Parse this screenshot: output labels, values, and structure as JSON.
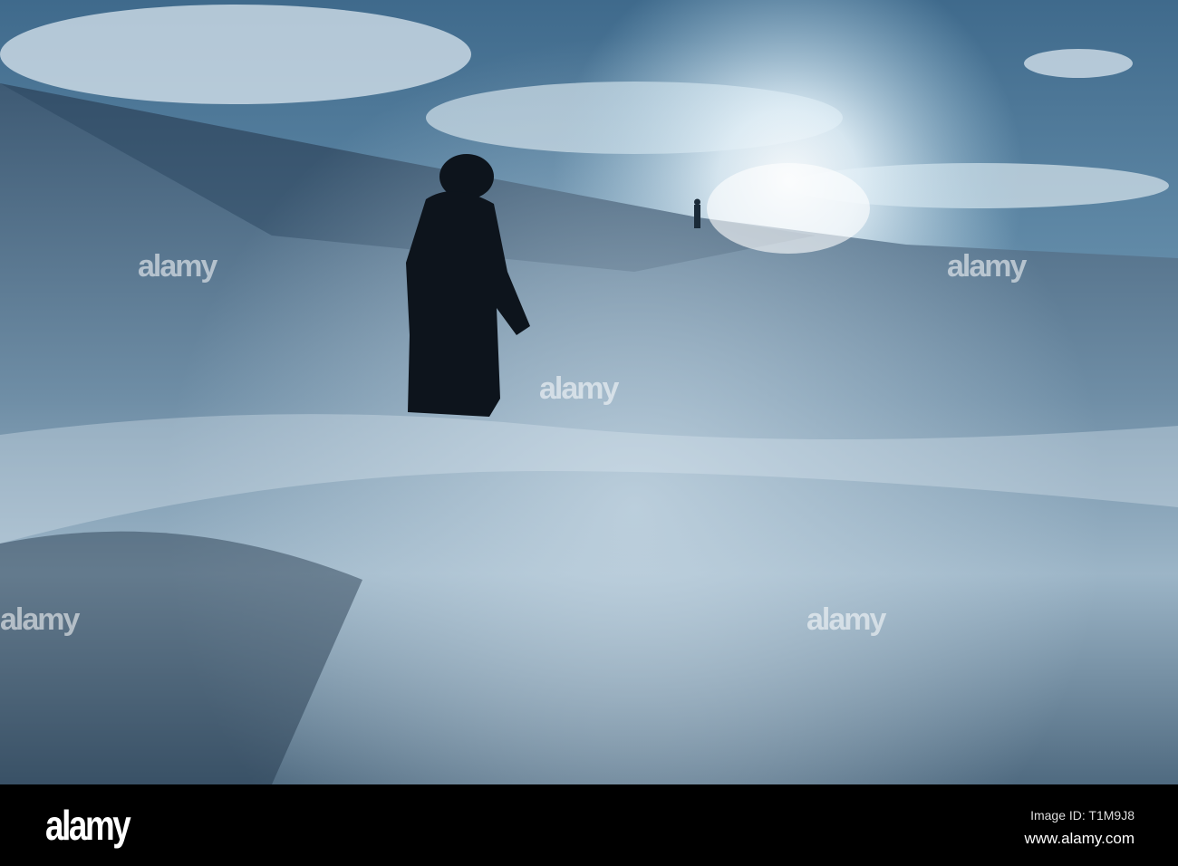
{
  "watermark": {
    "brand": "alamy"
  },
  "footer": {
    "logo": "alamy",
    "image_id": "Image ID: T1M9J8",
    "website": "www.alamy.com"
  }
}
